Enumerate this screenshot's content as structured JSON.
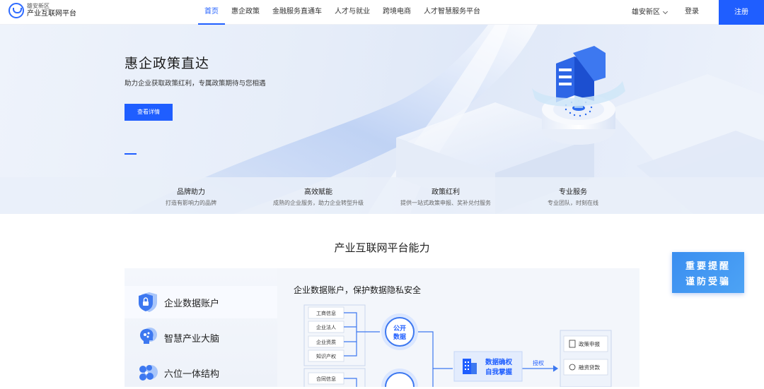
{
  "header": {
    "logo_sub": "雄安新区",
    "logo_main": "产业互联网平台",
    "nav": [
      "首页",
      "惠企政策",
      "金融服务直通车",
      "人才与就业",
      "跨境电商",
      "人才智慧服务平台"
    ],
    "region": "雄安新区",
    "login": "登录",
    "register": "注册"
  },
  "hero": {
    "title": "惠企政策直达",
    "desc": "助力企业获取政策红利，专属政策期待与您相遇",
    "button": "查看详情"
  },
  "features": [
    {
      "title": "品牌助力",
      "desc": "打造有影响力的品牌"
    },
    {
      "title": "高效赋能",
      "desc": "成熟的企业服务，助力企业转型升级"
    },
    {
      "title": "政策红利",
      "desc": "提供一站式政策申报、奖补兑付服务"
    },
    {
      "title": "专业服务",
      "desc": "专业团队，时刻在线"
    }
  ],
  "section": {
    "title": "产业互联网平台能力",
    "tabs": [
      "企业数据账户",
      "智慧产业大脑",
      "六位一体结构"
    ],
    "panel_title": "企业数据账户，保护数据隐私安全",
    "diagram": {
      "inputs_top": [
        "工商信息",
        "企业法人",
        "企业资质",
        "知识产权"
      ],
      "inputs_bottom": [
        "合同信息"
      ],
      "hub_lines": [
        "公开",
        "数据"
      ],
      "center_lines": [
        "数据确权",
        "自我掌握"
      ],
      "arrow_label": "授权",
      "outputs": [
        "政策申报",
        "融资贷款"
      ]
    }
  },
  "badge": {
    "line1": "重要提醒",
    "line2": "谨防受骗"
  },
  "colors": {
    "primary": "#1f5eff",
    "badge": "#3a8ef0"
  }
}
